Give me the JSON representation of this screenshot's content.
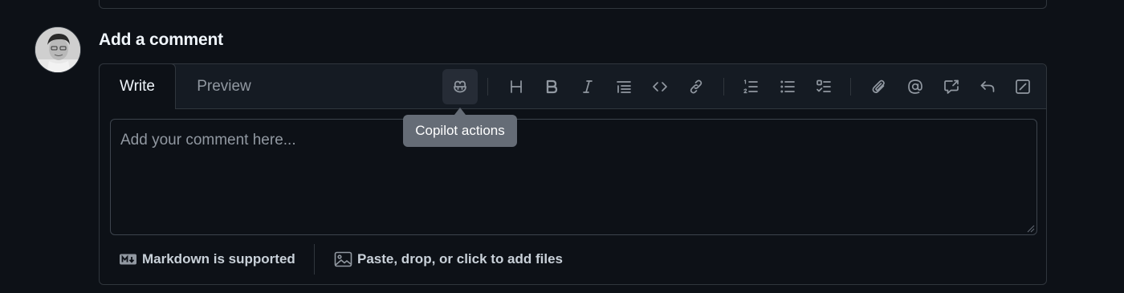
{
  "comment": {
    "heading": "Add a comment",
    "tabs": {
      "write": "Write",
      "preview": "Preview"
    },
    "textarea_placeholder": "Add your comment here...",
    "tooltip": "Copilot actions",
    "toolbar_icons": [
      "copilot-icon",
      "heading-icon",
      "bold-icon",
      "italic-icon",
      "quote-icon",
      "code-icon",
      "link-icon",
      "ordered-list-icon",
      "unordered-list-icon",
      "task-list-icon",
      "attach-icon",
      "mention-icon",
      "reference-icon",
      "reply-icon",
      "slash-command-icon"
    ],
    "footer": {
      "markdown_label": "Markdown is supported",
      "files_label": "Paste, drop, or click to add files"
    }
  },
  "colors": {
    "background": "#0d1117",
    "border": "#30363d",
    "tabbar_bg": "#151b23",
    "tooltip_bg": "#656c76"
  }
}
